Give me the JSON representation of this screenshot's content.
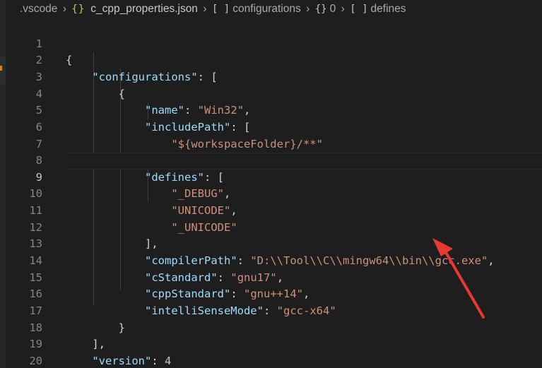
{
  "breadcrumb": {
    "folder": ".vscode",
    "file_icon": "{}",
    "file": "c_cpp_properties.json",
    "seg1_icon": "[ ]",
    "seg1": "configurations",
    "seg2_icon": "{}",
    "seg2": "0",
    "seg3_icon": "[ ]",
    "seg3": "defines",
    "separator": "›"
  },
  "editor": {
    "current_line": 9,
    "lines": [
      {
        "num": "1"
      },
      {
        "num": "2",
        "key": "configurations"
      },
      {
        "num": "3"
      },
      {
        "num": "4",
        "key": "name",
        "value": "Win32"
      },
      {
        "num": "5",
        "key": "includePath"
      },
      {
        "num": "6",
        "value": "${workspaceFolder}/**"
      },
      {
        "num": "7"
      },
      {
        "num": "8",
        "key": "defines"
      },
      {
        "num": "9",
        "value": "_DEBUG"
      },
      {
        "num": "10",
        "value": "UNICODE"
      },
      {
        "num": "11",
        "value": "_UNICODE"
      },
      {
        "num": "12"
      },
      {
        "num": "13",
        "key": "compilerPath",
        "value": "D:\\\\Tool\\\\C\\\\mingw64\\\\bin\\\\gcc.exe"
      },
      {
        "num": "14",
        "key": "cStandard",
        "value": "gnu17"
      },
      {
        "num": "15",
        "key": "cppStandard",
        "value": "gnu++14"
      },
      {
        "num": "16",
        "key": "intelliSenseMode",
        "value": "gcc-x64"
      },
      {
        "num": "17"
      },
      {
        "num": "18"
      },
      {
        "num": "19",
        "key": "version",
        "number": "4"
      },
      {
        "num": "20"
      }
    ]
  },
  "annotation": {
    "icon": "red-arrow-icon",
    "color": "#e8382f"
  },
  "colors": {
    "background": "#1e1e1e",
    "key": "#9cdcfe",
    "string": "#ce9178",
    "number": "#b5cea8",
    "punctuation": "#d4d4d4",
    "line_number": "#858585"
  }
}
